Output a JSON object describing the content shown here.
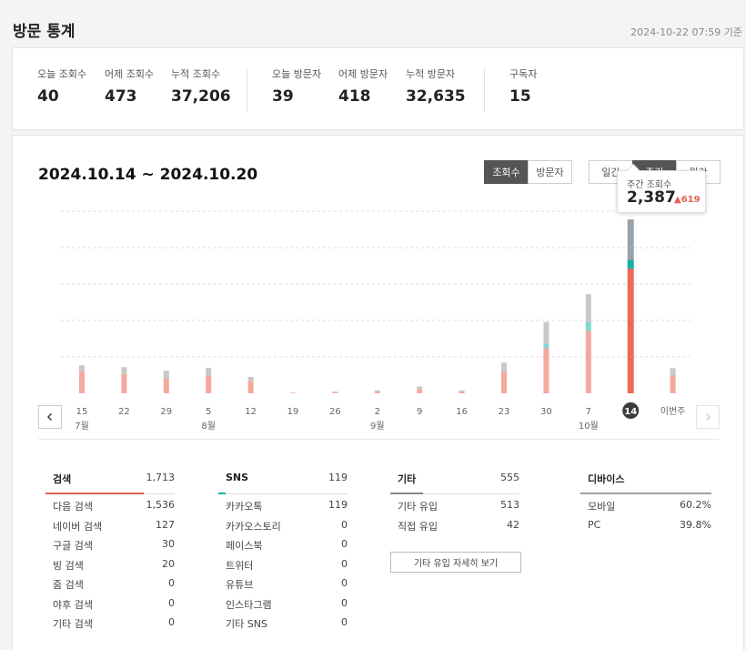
{
  "page": {
    "title": "방문 통계",
    "base_time": "2024-10-22 07:59 기준"
  },
  "summary": [
    {
      "label": "오늘 조회수",
      "value": "40"
    },
    {
      "label": "어제 조회수",
      "value": "473"
    },
    {
      "label": "누적 조회수",
      "value": "37,206"
    },
    {
      "label": "오늘 방문자",
      "value": "39"
    },
    {
      "label": "어제 방문자",
      "value": "418"
    },
    {
      "label": "누적 방문자",
      "value": "32,635"
    },
    {
      "label": "구독자",
      "value": "15"
    }
  ],
  "chart_panel": {
    "range": "2024.10.14 ~ 2024.10.20",
    "metric_tabs": [
      {
        "label": "조회수",
        "active": true
      },
      {
        "label": "방문자",
        "active": false
      }
    ],
    "period_tabs": [
      {
        "label": "일간",
        "active": false
      },
      {
        "label": "주간",
        "active": true
      },
      {
        "label": "월간",
        "active": false
      }
    ],
    "tooltip": {
      "title": "주간 조회수",
      "value": "2,387",
      "diff": "▲619"
    },
    "nav": {
      "prev_icon": "chevron-left-icon",
      "next_icon": "chevron-right-icon"
    }
  },
  "colors": {
    "search": "#f4a99c",
    "sns": "#7fd8cf",
    "other": "#c9c9c9",
    "highlight_search": "#ef6a56",
    "highlight_sns": "#13b3a3",
    "highlight_other": "#9aa2aa"
  },
  "chart_data": {
    "type": "bar",
    "stacked": true,
    "categories": [
      "15",
      "22",
      "29",
      "5",
      "12",
      "19",
      "26",
      "2",
      "9",
      "16",
      "23",
      "30",
      "7",
      "14",
      "이번주"
    ],
    "month_labels": [
      {
        "label": "7월",
        "at_index": 0
      },
      {
        "label": "8월",
        "at_index": 3
      },
      {
        "label": "9월",
        "at_index": 7
      },
      {
        "label": "10월",
        "at_index": 12
      }
    ],
    "highlight_index": 13,
    "series": [
      {
        "name": "검색",
        "values": [
          305,
          265,
          200,
          245,
          165,
          8,
          15,
          25,
          55,
          25,
          300,
          620,
          860,
          1713,
          245
        ]
      },
      {
        "name": "SNS",
        "values": [
          0,
          0,
          0,
          0,
          0,
          0,
          0,
          0,
          0,
          0,
          0,
          60,
          120,
          119,
          0
        ]
      },
      {
        "name": "기타",
        "values": [
          80,
          95,
          110,
          105,
          60,
          0,
          10,
          15,
          40,
          15,
          120,
          300,
          380,
          555,
          100
        ]
      }
    ],
    "ylim": [
      0,
      2500
    ],
    "grid": true
  },
  "sections": [
    {
      "title": "검색",
      "total": "1,713",
      "accent": "#e8604c",
      "accent_width": 108,
      "rows": [
        {
          "label": "다음 검색",
          "value": "1,536"
        },
        {
          "label": "네이버 검색",
          "value": "127"
        },
        {
          "label": "구글 검색",
          "value": "30"
        },
        {
          "label": "빙 검색",
          "value": "20"
        },
        {
          "label": "줌 검색",
          "value": "0"
        },
        {
          "label": "야후 검색",
          "value": "0"
        },
        {
          "label": "기타 검색",
          "value": "0"
        }
      ]
    },
    {
      "title": "SNS",
      "total": "119",
      "accent": "#13b3a3",
      "accent_width": 8,
      "rows": [
        {
          "label": "카카오톡",
          "value": "119"
        },
        {
          "label": "카카오스토리",
          "value": "0"
        },
        {
          "label": "페이스북",
          "value": "0"
        },
        {
          "label": "트위터",
          "value": "0"
        },
        {
          "label": "유튜브",
          "value": "0"
        },
        {
          "label": "인스타그램",
          "value": "0"
        },
        {
          "label": "기타 SNS",
          "value": "0"
        }
      ]
    },
    {
      "title": "기타",
      "total": "555",
      "accent": "#888888",
      "accent_width": 36,
      "rows": [
        {
          "label": "기타 유입",
          "value": "513"
        },
        {
          "label": "직접 유입",
          "value": "42"
        }
      ],
      "button": "기타 유입 자세히 보기"
    },
    {
      "title": "디바이스",
      "total": "",
      "accent": "#9aa2aa",
      "accent_width": 144,
      "rows": [
        {
          "label": "모바일",
          "value": "60.2%"
        },
        {
          "label": "PC",
          "value": "39.8%"
        }
      ]
    }
  ]
}
